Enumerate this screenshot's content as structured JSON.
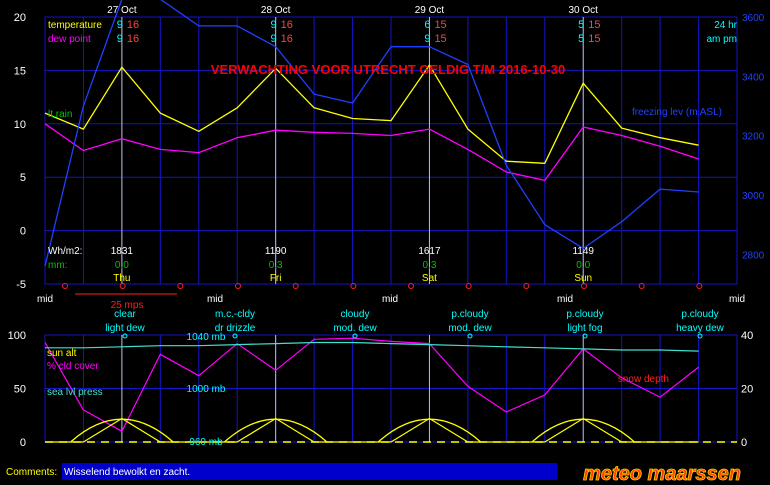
{
  "title": "VERWACHTING VOOR UTRECHT GELDIG T/M 2016-10-30",
  "colors": {
    "grid": "#1414c8",
    "axis_text": "#ffffff",
    "temperature": "#ffff00",
    "dew_point": "#ff00ff",
    "freezing_level": "#2040ff",
    "rain": "#00c000",
    "title": "#ff0000",
    "cyan": "#00ffff",
    "pressure": "#40e0d0",
    "sun": "#ffff00",
    "cloud": "#ff00ff",
    "snow": "#ff2020",
    "wind_marker": "#ff2020",
    "comment_bg": "#0000cc"
  },
  "top_panel": {
    "y_left_ticks": [
      "20",
      "15",
      "10",
      "5",
      "0",
      "-5"
    ],
    "y_right_ticks": [
      "3600",
      "3400",
      "3200",
      "3000",
      "2800"
    ],
    "day_labels": [
      "27 Oct",
      "28 Oct",
      "29 Oct",
      "30 Oct"
    ],
    "legend": {
      "temperature": "temperature",
      "dew_point": "dew point",
      "rain": "lt.rain",
      "freezing": "freezing lev (m ASL)",
      "hr24": "24 hr",
      "ampm": "am pm"
    },
    "temp_values": [
      [
        "9",
        "16"
      ],
      [
        "9",
        "16"
      ],
      [
        "6",
        "15"
      ],
      [
        "5",
        "15"
      ]
    ],
    "dew_values": [
      [
        "9",
        "16"
      ],
      [
        "9",
        "16"
      ],
      [
        "9",
        "15"
      ],
      [
        "5",
        "15"
      ]
    ],
    "wh_label": "Wh/m2:",
    "mm_label": "mm:",
    "radiation": [
      "1831",
      "1190",
      "1617",
      "1149"
    ],
    "precip": [
      "0,0",
      "0,3",
      "0,3",
      "0,0"
    ],
    "weekdays": [
      "Thu",
      "Fri",
      "Sat",
      "Sun"
    ],
    "wind_scale_label": "25 mps"
  },
  "mid_labels": [
    "mid",
    "mid",
    "mid",
    "mid",
    "mid"
  ],
  "conditions": [
    {
      "sky": "clear",
      "precip": "light dew"
    },
    {
      "sky": "m.c.-cldy",
      "precip": "dr drizzle"
    },
    {
      "sky": "cloudy",
      "precip": "mod. dew"
    },
    {
      "sky": "p.cloudy",
      "precip": "mod. dew"
    },
    {
      "sky": "p.cloudy",
      "precip": "light fog"
    },
    {
      "sky": "p.cloudy",
      "precip": "heavy dew"
    }
  ],
  "bottom_panel": {
    "y_left_ticks": [
      "100",
      "50",
      "0"
    ],
    "y_right_ticks": [
      "40",
      "20",
      "0"
    ],
    "legend": {
      "sun_alt": "sun alt",
      "cloud": "% cld cover",
      "pressure": "sea lvl press",
      "snow": "snow depth"
    },
    "pressure_labels": [
      "1040 mb",
      "1000 mb",
      "960 mb"
    ]
  },
  "comments": {
    "label": "Comments:",
    "text": "Wisselend bewolkt en zacht."
  },
  "brand": "meteo maarssen",
  "chart_data": [
    {
      "type": "line",
      "title": "VERWACHTING VOOR UTRECHT GELDIG T/M 2016-10-30",
      "x": [
        0,
        6,
        12,
        18,
        24,
        30,
        36,
        42,
        48,
        54,
        60,
        66,
        72,
        78,
        84,
        90,
        96,
        102
      ],
      "x_unit": "hours from midnight 27 Oct",
      "ylim": [
        -5,
        20
      ],
      "y2lim": [
        2700,
        3600
      ],
      "series": [
        {
          "name": "temperature",
          "values": [
            11,
            9.5,
            15.3,
            11,
            9.3,
            11.5,
            15.2,
            11.5,
            10.5,
            10.3,
            15.5,
            9.5,
            6.5,
            6.3,
            13.8,
            9.6,
            8.7,
            8
          ]
        },
        {
          "name": "dew point",
          "values": [
            10,
            7.5,
            8.6,
            7.6,
            7.3,
            8.7,
            9.4,
            9.2,
            9.1,
            8.9,
            9.5,
            7.6,
            5.5,
            4.7,
            9.7,
            8.9,
            7.9,
            6.7
          ]
        },
        {
          "name": "freezing lev (m ASL)",
          "axis": "right",
          "values": [
            2760,
            3300,
            3660,
            3660,
            3570,
            3570,
            3500,
            3340,
            3310,
            3500,
            3500,
            3440,
            3100,
            2900,
            2820,
            2910,
            3020,
            3010
          ]
        }
      ]
    },
    {
      "type": "line",
      "x": [
        0,
        6,
        12,
        18,
        24,
        30,
        36,
        42,
        48,
        54,
        60,
        66,
        72,
        78,
        84,
        90,
        96,
        102
      ],
      "ylim": [
        0,
        100
      ],
      "y2lim": [
        0,
        40
      ],
      "series": [
        {
          "name": "% cld cover",
          "values": [
            93,
            30,
            10,
            82,
            62,
            92,
            67,
            96,
            97,
            94,
            92,
            52,
            28,
            44,
            87,
            60,
            42,
            70
          ]
        },
        {
          "name": "sea lvl press",
          "values": [
            88,
            88,
            89,
            90,
            90,
            91,
            92,
            93,
            93,
            92,
            91,
            90,
            89,
            88,
            87,
            86,
            86,
            85
          ]
        },
        {
          "name": "sun alt",
          "values": [
            0,
            0,
            22,
            0,
            0,
            0,
            22,
            0,
            0,
            0,
            22,
            0,
            0,
            0,
            22,
            0,
            0,
            0
          ]
        }
      ]
    }
  ]
}
